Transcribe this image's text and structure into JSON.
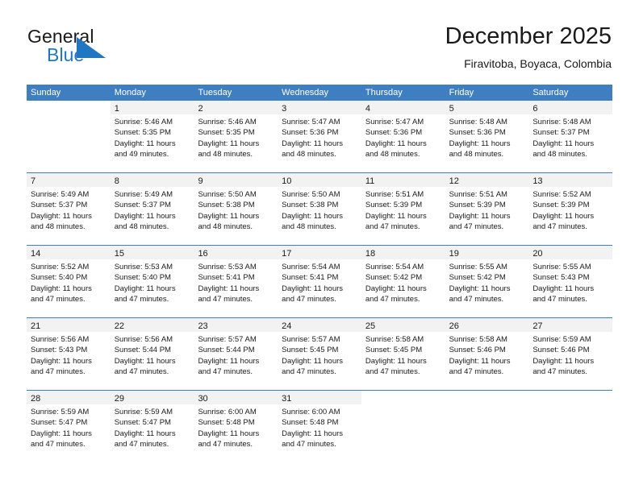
{
  "brand": {
    "line1": "General",
    "line2": "Blue",
    "triangle_color": "#1f77c4",
    "text_color": "#1a1a1a"
  },
  "header": {
    "title": "December 2025",
    "subtitle": "Firavitoba, Boyaca, Colombia"
  },
  "theme": {
    "header_bar": "#3f7fc1",
    "date_band": "#f2f2f2",
    "text": "#1a1a1a",
    "accent": "#1f77c4"
  },
  "weekdays": [
    "Sunday",
    "Monday",
    "Tuesday",
    "Wednesday",
    "Thursday",
    "Friday",
    "Saturday"
  ],
  "weeks": [
    [
      {
        "day": "",
        "lines": []
      },
      {
        "day": "1",
        "lines": [
          "Sunrise: 5:46 AM",
          "Sunset: 5:35 PM",
          "Daylight: 11 hours",
          "and 49 minutes."
        ]
      },
      {
        "day": "2",
        "lines": [
          "Sunrise: 5:46 AM",
          "Sunset: 5:35 PM",
          "Daylight: 11 hours",
          "and 48 minutes."
        ]
      },
      {
        "day": "3",
        "lines": [
          "Sunrise: 5:47 AM",
          "Sunset: 5:36 PM",
          "Daylight: 11 hours",
          "and 48 minutes."
        ]
      },
      {
        "day": "4",
        "lines": [
          "Sunrise: 5:47 AM",
          "Sunset: 5:36 PM",
          "Daylight: 11 hours",
          "and 48 minutes."
        ]
      },
      {
        "day": "5",
        "lines": [
          "Sunrise: 5:48 AM",
          "Sunset: 5:36 PM",
          "Daylight: 11 hours",
          "and 48 minutes."
        ]
      },
      {
        "day": "6",
        "lines": [
          "Sunrise: 5:48 AM",
          "Sunset: 5:37 PM",
          "Daylight: 11 hours",
          "and 48 minutes."
        ]
      }
    ],
    [
      {
        "day": "7",
        "lines": [
          "Sunrise: 5:49 AM",
          "Sunset: 5:37 PM",
          "Daylight: 11 hours",
          "and 48 minutes."
        ]
      },
      {
        "day": "8",
        "lines": [
          "Sunrise: 5:49 AM",
          "Sunset: 5:37 PM",
          "Daylight: 11 hours",
          "and 48 minutes."
        ]
      },
      {
        "day": "9",
        "lines": [
          "Sunrise: 5:50 AM",
          "Sunset: 5:38 PM",
          "Daylight: 11 hours",
          "and 48 minutes."
        ]
      },
      {
        "day": "10",
        "lines": [
          "Sunrise: 5:50 AM",
          "Sunset: 5:38 PM",
          "Daylight: 11 hours",
          "and 48 minutes."
        ]
      },
      {
        "day": "11",
        "lines": [
          "Sunrise: 5:51 AM",
          "Sunset: 5:39 PM",
          "Daylight: 11 hours",
          "and 47 minutes."
        ]
      },
      {
        "day": "12",
        "lines": [
          "Sunrise: 5:51 AM",
          "Sunset: 5:39 PM",
          "Daylight: 11 hours",
          "and 47 minutes."
        ]
      },
      {
        "day": "13",
        "lines": [
          "Sunrise: 5:52 AM",
          "Sunset: 5:39 PM",
          "Daylight: 11 hours",
          "and 47 minutes."
        ]
      }
    ],
    [
      {
        "day": "14",
        "lines": [
          "Sunrise: 5:52 AM",
          "Sunset: 5:40 PM",
          "Daylight: 11 hours",
          "and 47 minutes."
        ]
      },
      {
        "day": "15",
        "lines": [
          "Sunrise: 5:53 AM",
          "Sunset: 5:40 PM",
          "Daylight: 11 hours",
          "and 47 minutes."
        ]
      },
      {
        "day": "16",
        "lines": [
          "Sunrise: 5:53 AM",
          "Sunset: 5:41 PM",
          "Daylight: 11 hours",
          "and 47 minutes."
        ]
      },
      {
        "day": "17",
        "lines": [
          "Sunrise: 5:54 AM",
          "Sunset: 5:41 PM",
          "Daylight: 11 hours",
          "and 47 minutes."
        ]
      },
      {
        "day": "18",
        "lines": [
          "Sunrise: 5:54 AM",
          "Sunset: 5:42 PM",
          "Daylight: 11 hours",
          "and 47 minutes."
        ]
      },
      {
        "day": "19",
        "lines": [
          "Sunrise: 5:55 AM",
          "Sunset: 5:42 PM",
          "Daylight: 11 hours",
          "and 47 minutes."
        ]
      },
      {
        "day": "20",
        "lines": [
          "Sunrise: 5:55 AM",
          "Sunset: 5:43 PM",
          "Daylight: 11 hours",
          "and 47 minutes."
        ]
      }
    ],
    [
      {
        "day": "21",
        "lines": [
          "Sunrise: 5:56 AM",
          "Sunset: 5:43 PM",
          "Daylight: 11 hours",
          "and 47 minutes."
        ]
      },
      {
        "day": "22",
        "lines": [
          "Sunrise: 5:56 AM",
          "Sunset: 5:44 PM",
          "Daylight: 11 hours",
          "and 47 minutes."
        ]
      },
      {
        "day": "23",
        "lines": [
          "Sunrise: 5:57 AM",
          "Sunset: 5:44 PM",
          "Daylight: 11 hours",
          "and 47 minutes."
        ]
      },
      {
        "day": "24",
        "lines": [
          "Sunrise: 5:57 AM",
          "Sunset: 5:45 PM",
          "Daylight: 11 hours",
          "and 47 minutes."
        ]
      },
      {
        "day": "25",
        "lines": [
          "Sunrise: 5:58 AM",
          "Sunset: 5:45 PM",
          "Daylight: 11 hours",
          "and 47 minutes."
        ]
      },
      {
        "day": "26",
        "lines": [
          "Sunrise: 5:58 AM",
          "Sunset: 5:46 PM",
          "Daylight: 11 hours",
          "and 47 minutes."
        ]
      },
      {
        "day": "27",
        "lines": [
          "Sunrise: 5:59 AM",
          "Sunset: 5:46 PM",
          "Daylight: 11 hours",
          "and 47 minutes."
        ]
      }
    ],
    [
      {
        "day": "28",
        "lines": [
          "Sunrise: 5:59 AM",
          "Sunset: 5:47 PM",
          "Daylight: 11 hours",
          "and 47 minutes."
        ]
      },
      {
        "day": "29",
        "lines": [
          "Sunrise: 5:59 AM",
          "Sunset: 5:47 PM",
          "Daylight: 11 hours",
          "and 47 minutes."
        ]
      },
      {
        "day": "30",
        "lines": [
          "Sunrise: 6:00 AM",
          "Sunset: 5:48 PM",
          "Daylight: 11 hours",
          "and 47 minutes."
        ]
      },
      {
        "day": "31",
        "lines": [
          "Sunrise: 6:00 AM",
          "Sunset: 5:48 PM",
          "Daylight: 11 hours",
          "and 47 minutes."
        ]
      },
      {
        "day": "",
        "lines": []
      },
      {
        "day": "",
        "lines": []
      },
      {
        "day": "",
        "lines": []
      }
    ]
  ]
}
